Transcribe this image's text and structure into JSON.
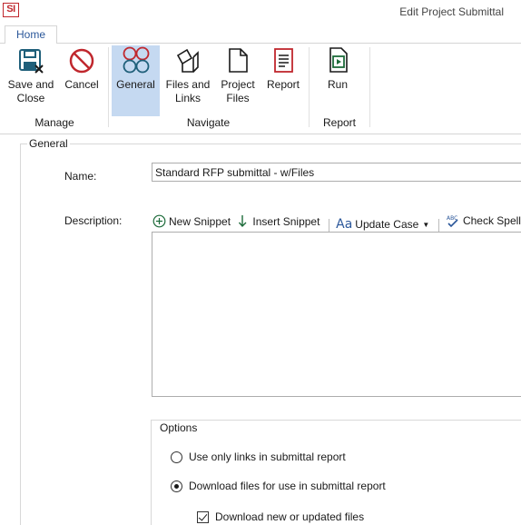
{
  "window": {
    "title": "Edit Project Submittal",
    "logo_text": "SI"
  },
  "ribbon": {
    "tabs": [
      {
        "label": "Home"
      }
    ],
    "groups": [
      {
        "label": "Manage",
        "buttons": [
          {
            "label": "Save and\nClose",
            "icon": "save-close-icon"
          },
          {
            "label": "Cancel",
            "icon": "cancel-icon"
          }
        ]
      },
      {
        "label": "Navigate",
        "buttons": [
          {
            "label": "General",
            "icon": "general-icon",
            "selected": true
          },
          {
            "label": "Files and\nLinks",
            "icon": "files-links-icon"
          },
          {
            "label": "Project\nFiles",
            "icon": "project-files-icon"
          },
          {
            "label": "Report",
            "icon": "report-icon"
          }
        ]
      },
      {
        "label": "Report",
        "buttons": [
          {
            "label": "Run",
            "icon": "run-icon"
          }
        ]
      }
    ]
  },
  "general": {
    "section_label": "General",
    "name_label": "Name:",
    "name_value": "Standard RFP submittal - w/Files",
    "description_label": "Description:",
    "toolbar": {
      "new_snippet": "New Snippet",
      "insert_snippet": "Insert Snippet",
      "update_case": "Update Case",
      "check_spelling": "Check Spellin"
    },
    "description_value": ""
  },
  "options": {
    "label": "Options",
    "radio_links_only": "Use only links in submittal report",
    "radio_download": "Download files for use in submittal report",
    "check_download_new": "Download new or updated files",
    "selected_radio": "download",
    "download_new_checked": true
  },
  "colors": {
    "accent": "#2b579a",
    "selected_bg": "#c5d9f1",
    "icon_blue": "#1f5f7a",
    "icon_red": "#c0272d",
    "icon_green": "#1d6b3a"
  }
}
